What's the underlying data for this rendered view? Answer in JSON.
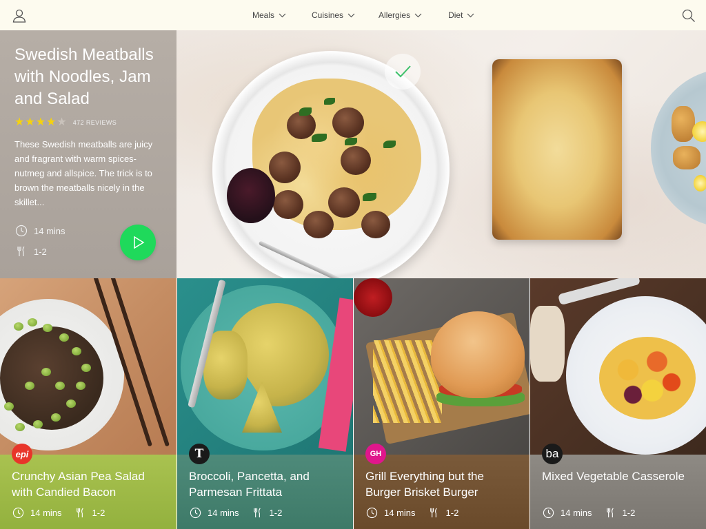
{
  "nav": {
    "items": [
      {
        "label": "Meals"
      },
      {
        "label": "Cuisines"
      },
      {
        "label": "Allergies"
      },
      {
        "label": "Diet"
      }
    ]
  },
  "hero": {
    "title": "Swedish Meatballs with Noodles, Jam and Salad",
    "rating": 4,
    "rating_max": 5,
    "reviews": "472 REVIEWS",
    "description": "These Swedish meatballs are juicy and fragrant with warm spices-nutmeg and allspice. The trick is to brown the meatballs nicely in the skillet...",
    "time": "14 mins",
    "servings": "1-2",
    "play_color": "#1fd95b",
    "star_color": "#f5d20f"
  },
  "cards": [
    {
      "title": "Crunchy Asian Pea Salad with Candied Bacon",
      "source": "epi",
      "source_color": "#e8352a",
      "time": "14 mins",
      "servings": "1-2"
    },
    {
      "title": "Broccoli, Pancetta, and Parmesan Frittata",
      "source": "T",
      "source_color": "#1a1a1a",
      "time": "14 mins",
      "servings": "1-2"
    },
    {
      "title": "Grill Everything but the Burger Brisket Burger",
      "source": "GH",
      "source_color": "#e0168c",
      "time": "14 mins",
      "servings": "1-2"
    },
    {
      "title": "Mixed Vegetable Casserole",
      "source": "ba",
      "source_color": "#1a1a1a",
      "time": "14 mins",
      "servings": "1-2"
    }
  ]
}
